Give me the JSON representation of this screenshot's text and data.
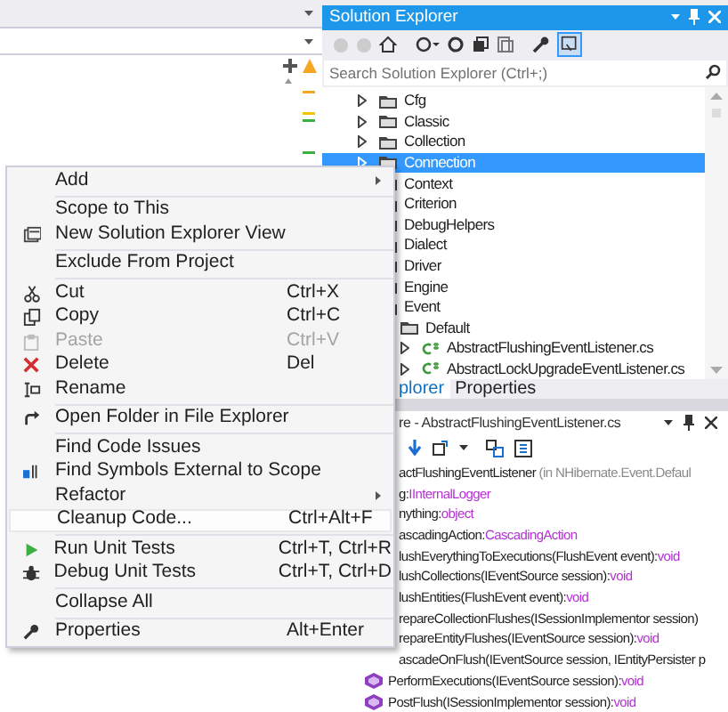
{
  "solution_explorer": {
    "title": "Solution Explorer",
    "search": {
      "placeholder": "Search Solution Explorer (Ctrl+;)"
    },
    "tree": [
      {
        "label": "Cfg",
        "expanded": false,
        "selected": false
      },
      {
        "label": "Classic",
        "expanded": false,
        "selected": false
      },
      {
        "label": "Collection",
        "expanded": false,
        "selected": false
      },
      {
        "label": "Connection",
        "expanded": false,
        "selected": true
      },
      {
        "label": "Context",
        "selected": false
      },
      {
        "label": "Criterion",
        "selected": false
      },
      {
        "label": "DebugHelpers",
        "selected": false
      },
      {
        "label": "Dialect",
        "selected": false
      },
      {
        "label": "Driver",
        "selected": false
      },
      {
        "label": "Engine",
        "selected": false
      },
      {
        "label": "Event",
        "selected": false,
        "children": [
          {
            "label": "Default",
            "selected": false,
            "children": [
              {
                "label": "AbstractFlushingEventListener.cs",
                "expanded": false,
                "selected": false
              },
              {
                "label": "AbstractLockUpgradeEventListener.cs",
                "expanded": false,
                "selected": false
              }
            ]
          }
        ]
      }
    ],
    "tabs": [
      {
        "label": "plorer",
        "selected": true
      },
      {
        "label": "Properties",
        "selected": false
      }
    ]
  },
  "file_structure": {
    "title": "re - AbstractFlushingEventListener.cs",
    "rows": [
      {
        "kind": "partial",
        "text": "actFlushingEventListener",
        "detail": "(in NHibernate.Event.Defaul"
      },
      {
        "kind": "partial",
        "text": "g:",
        "type": "IInternalLogger"
      },
      {
        "kind": "partial",
        "text": "nything:",
        "type": "object"
      },
      {
        "kind": "partial",
        "text": "ascadingAction:",
        "type": "CascadingAction"
      },
      {
        "kind": "partial",
        "text": "lushEverythingToExecutions(FlushEvent event):",
        "type": "void"
      },
      {
        "kind": "partial",
        "text": "lushCollections(IEventSource session):",
        "type": "void"
      },
      {
        "kind": "partial",
        "text": "lushEntities(FlushEvent event):",
        "type": "void"
      },
      {
        "kind": "partial",
        "text": "repareCollectionFlushes(ISessionImplementor session)"
      },
      {
        "kind": "partial",
        "text": "repareEntityFlushes(IEventSource session):",
        "type": "void"
      },
      {
        "kind": "partial",
        "text": "ascadeOnFlush(IEventSource session, IEntityPersister p"
      },
      {
        "kind": "member",
        "text": "PerformExecutions(IEventSource session):",
        "type": "void"
      },
      {
        "kind": "member",
        "text": "PostFlush(ISessionImplementor session):",
        "type": "void"
      }
    ]
  },
  "context_menu": [
    {
      "kind": "item",
      "label": "Add",
      "submenu": true,
      "selected": false
    },
    {
      "kind": "separator"
    },
    {
      "kind": "item",
      "label": "Scope to This",
      "selected": false
    },
    {
      "kind": "item",
      "label": "New Solution Explorer View",
      "selected": false
    },
    {
      "kind": "separator"
    },
    {
      "kind": "item",
      "label": "Exclude From Project",
      "selected": false
    },
    {
      "kind": "separator"
    },
    {
      "kind": "item",
      "label": "Cut",
      "shortcut": "Ctrl+X",
      "selected": false
    },
    {
      "kind": "item",
      "label": "Copy",
      "shortcut": "Ctrl+C",
      "selected": false
    },
    {
      "kind": "item",
      "label": "Paste",
      "shortcut": "Ctrl+V",
      "disabled": true,
      "selected": false
    },
    {
      "kind": "item",
      "label": "Delete",
      "shortcut": "Del",
      "selected": false
    },
    {
      "kind": "item",
      "label": "Rename",
      "selected": false
    },
    {
      "kind": "separator"
    },
    {
      "kind": "item",
      "label": "Open Folder in File Explorer",
      "selected": false
    },
    {
      "kind": "separator"
    },
    {
      "kind": "item",
      "label": "Find Code Issues",
      "selected": false
    },
    {
      "kind": "item",
      "label": "Find Symbols External to Scope",
      "selected": false
    },
    {
      "kind": "item",
      "label": "Refactor",
      "submenu": true,
      "selected": false
    },
    {
      "kind": "item",
      "label": "Cleanup Code...",
      "shortcut": "Ctrl+Alt+F",
      "selected": true
    },
    {
      "kind": "separator"
    },
    {
      "kind": "item",
      "label": "Run Unit Tests",
      "shortcut": "Ctrl+T, Ctrl+R",
      "selected": false
    },
    {
      "kind": "item",
      "label": "Debug Unit Tests",
      "shortcut": "Ctrl+T, Ctrl+D",
      "selected": false
    },
    {
      "kind": "separator"
    },
    {
      "kind": "item",
      "label": "Collapse All",
      "selected": false
    },
    {
      "kind": "separator"
    },
    {
      "kind": "item",
      "label": "Properties",
      "shortcut": "Alt+Enter",
      "selected": false
    }
  ]
}
